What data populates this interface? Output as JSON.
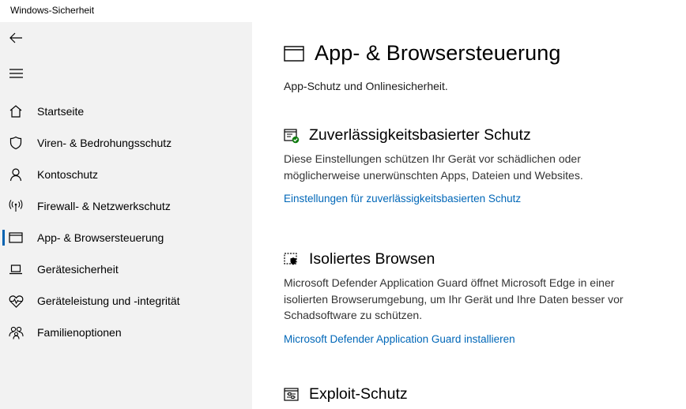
{
  "window": {
    "title": "Windows-Sicherheit"
  },
  "sidebar": {
    "back_icon": "back-arrow-icon",
    "menu_icon": "hamburger-menu-icon",
    "items": [
      {
        "label": "Startseite",
        "icon": "home-icon"
      },
      {
        "label": "Viren- & Bedrohungsschutz",
        "icon": "shield-icon"
      },
      {
        "label": "Kontoschutz",
        "icon": "person-icon"
      },
      {
        "label": "Firewall- & Netzwerkschutz",
        "icon": "antenna-icon"
      },
      {
        "label": "App- & Browsersteuerung",
        "icon": "browser-window-icon",
        "active": true
      },
      {
        "label": "Gerätesicherheit",
        "icon": "laptop-icon"
      },
      {
        "label": "Geräteleistung und -integrität",
        "icon": "heart-pulse-icon"
      },
      {
        "label": "Familienoptionen",
        "icon": "family-icon"
      }
    ]
  },
  "main": {
    "title": "App- & Browsersteuerung",
    "subtitle": "App-Schutz und Onlinesicherheit.",
    "sections": [
      {
        "title": "Zuverlässigkeitsbasierter Schutz",
        "icon": "reputation-check-icon",
        "description": "Diese Einstellungen schützen Ihr Gerät vor schädlichen oder möglicherweise unerwünschten Apps, Dateien und Websites.",
        "link": "Einstellungen für zuverlässigkeitsbasierten Schutz"
      },
      {
        "title": "Isoliertes Browsen",
        "icon": "isolated-browsing-icon",
        "description": "Microsoft Defender Application Guard öffnet Microsoft Edge in einer isolierten Browserumgebung, um Ihr Gerät und Ihre Daten besser vor Schadsoftware zu schützen.",
        "link": "Microsoft Defender Application Guard installieren"
      },
      {
        "title": "Exploit-Schutz",
        "icon": "exploit-protection-icon"
      }
    ]
  },
  "colors": {
    "sidebar_bg": "#f2f2f2",
    "accent": "#0063b1",
    "link": "#0067b8",
    "status_ok": "#107c10"
  }
}
